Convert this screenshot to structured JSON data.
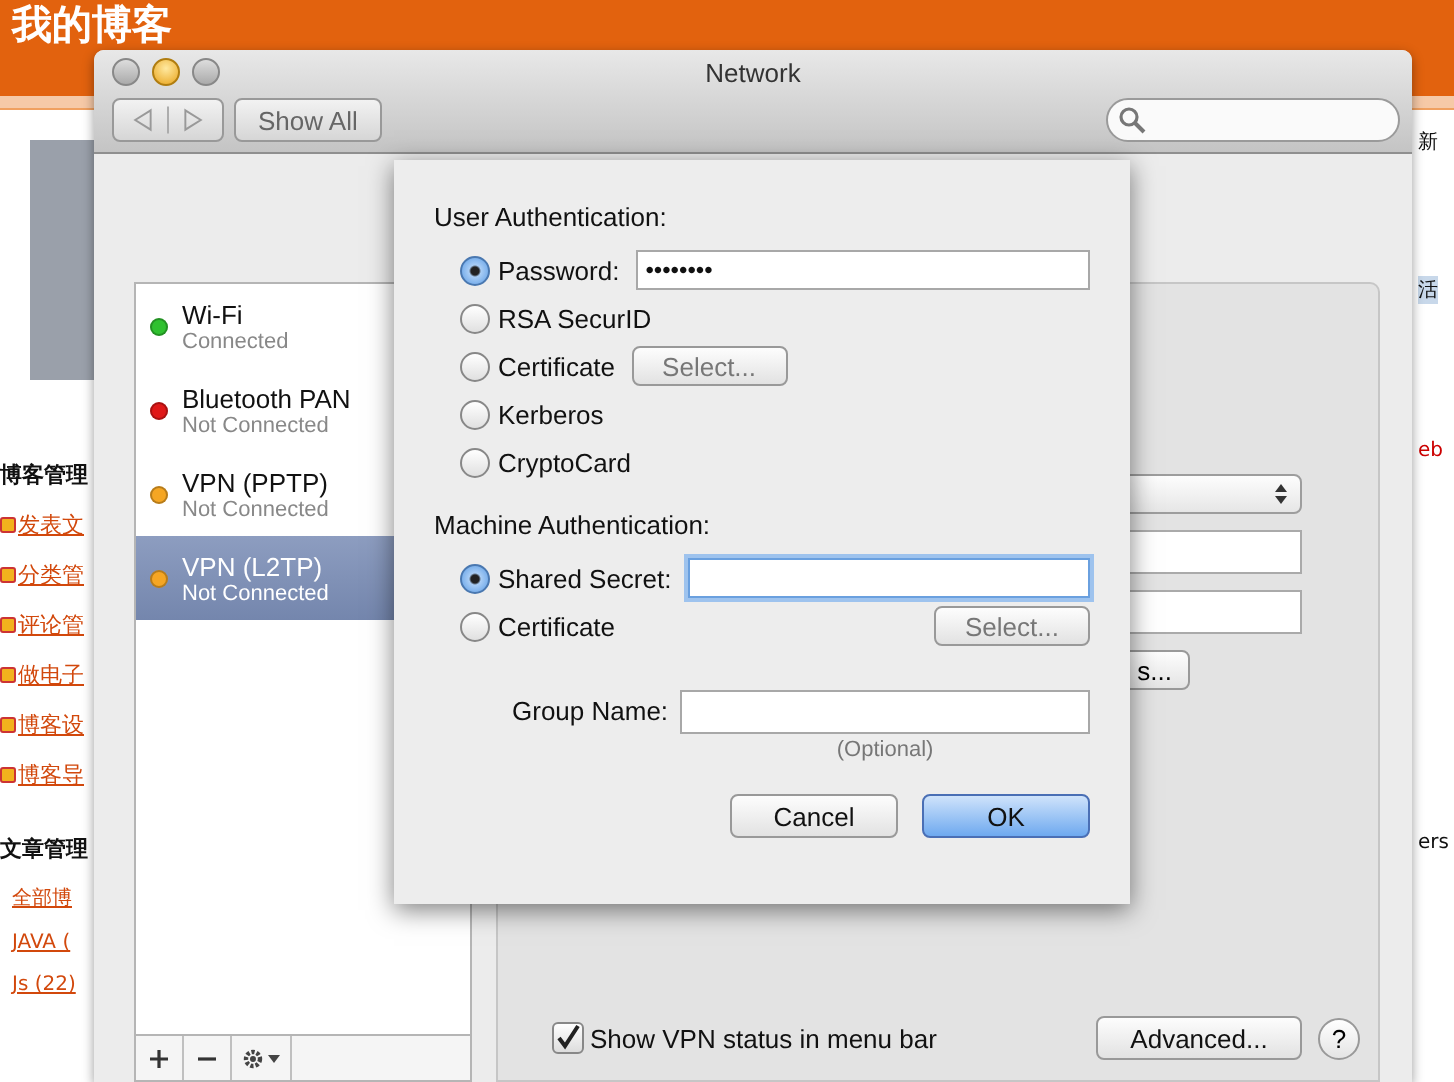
{
  "blog": {
    "title": "我的博客",
    "sections": [
      {
        "heading": "博客管理",
        "links": [
          {
            "text": "发表文",
            "icon": true
          },
          {
            "text": "分类管",
            "icon": true
          },
          {
            "text": "评论管",
            "icon": true
          },
          {
            "text": "做电子",
            "icon": true
          },
          {
            "text": "博客设",
            "icon": true
          },
          {
            "text": "博客导",
            "icon": true
          }
        ]
      },
      {
        "heading": "文章管理",
        "links": [
          {
            "text": "全部博",
            "icon": false
          },
          {
            "text": "JAVA (",
            "icon": false
          },
          {
            "text": "Js (22)",
            "icon": false
          }
        ]
      }
    ],
    "right_edge": [
      "新",
      "活",
      "eb",
      "ers"
    ]
  },
  "window": {
    "title": "Network",
    "show_all": "Show All"
  },
  "services": [
    {
      "name": "Wi-Fi",
      "status": "Connected",
      "color": "#2fc12f",
      "selected": false
    },
    {
      "name": "Bluetooth PAN",
      "status": "Not Connected",
      "color": "#e01818",
      "selected": false
    },
    {
      "name": "VPN (PPTP)",
      "status": "Not Connected",
      "color": "#f5a623",
      "selected": false
    },
    {
      "name": "VPN (L2TP)",
      "status": "Not Connected",
      "color": "#f5a623",
      "selected": true
    }
  ],
  "panel": {
    "auth_button": "s...",
    "show_status": {
      "label": "Show VPN status in menu bar",
      "checked": true
    },
    "advanced": "Advanced...",
    "help": "?"
  },
  "sheet": {
    "sections": [
      {
        "heading": "User Authentication:",
        "options": [
          {
            "kind": "password",
            "label": "Password:",
            "selected": true,
            "value": "••••••••"
          },
          {
            "kind": "plain",
            "label": "RSA SecurID",
            "selected": false
          },
          {
            "kind": "button",
            "label": "Certificate",
            "selected": false,
            "button": "Select..."
          },
          {
            "kind": "plain",
            "label": "Kerberos",
            "selected": false
          },
          {
            "kind": "plain",
            "label": "CryptoCard",
            "selected": false
          }
        ]
      },
      {
        "heading": "Machine Authentication:",
        "options": [
          {
            "kind": "field",
            "label": "Shared Secret:",
            "selected": true
          },
          {
            "kind": "button-right",
            "label": "Certificate",
            "selected": false,
            "button": "Select..."
          }
        ]
      }
    ],
    "group_name": {
      "label": "Group Name:",
      "hint": "(Optional)"
    },
    "buttons": [
      {
        "label": "Cancel",
        "default": false
      },
      {
        "label": "OK",
        "default": true
      }
    ]
  }
}
